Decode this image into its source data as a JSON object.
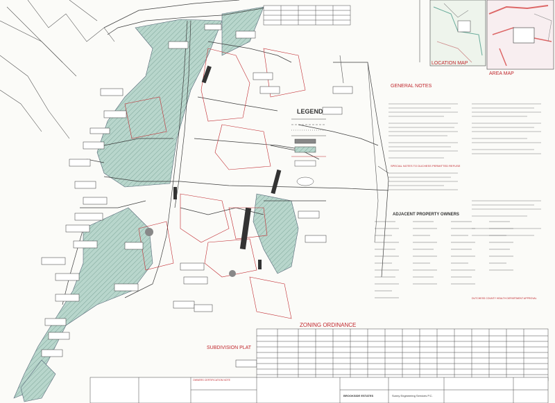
{
  "drawing": {
    "legend_title": "LEGEND",
    "general_notes_title": "GENERAL NOTES",
    "location_map_title": "LOCATION MAP",
    "area_map_title": "AREA MAP",
    "adjacent_owners_title": "ADJACENT PROPERTY OWNERS",
    "zoning_title": "ZONING ORDINANCE",
    "subdivision_plat_title": "SUBDIVISION PLAT",
    "dutchess_approval": "DUTCHESS COUNTY HEALTH DEPARTMENT APPROVAL",
    "special_notes": "SPECIAL NOTES TO DUCHESS PERMITTED REFUSE",
    "project_title": "BROOKSIDE ESTATES",
    "engineer": "Sunny Engineering Services P.C.",
    "owners_certification": "OWNERS CERTIFICATION NOTE"
  },
  "colors": {
    "wetland_hatch": "#a9c9bf",
    "linework": "#3a3a3a",
    "property_red": "#c0272d",
    "map_pink": "#e7a0a8"
  }
}
